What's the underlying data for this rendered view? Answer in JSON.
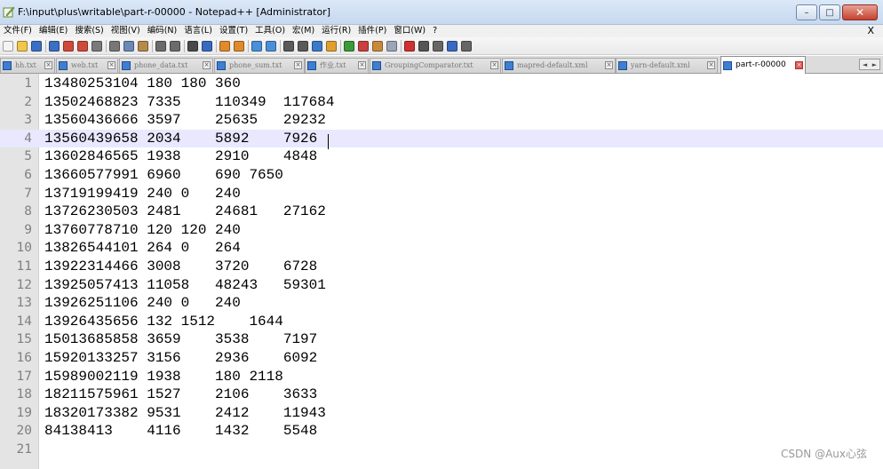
{
  "window": {
    "title": "F:\\input\\plus\\writable\\part-r-00000 - Notepad++ [Administrator]",
    "controls": [
      "–",
      "□",
      "✕"
    ]
  },
  "menubar": {
    "items": [
      "文件(F)",
      "编辑(E)",
      "搜索(S)",
      "视图(V)",
      "编码(N)",
      "语言(L)",
      "设置(T)",
      "工具(O)",
      "宏(M)",
      "运行(R)",
      "插件(P)",
      "窗口(W)",
      "?"
    ],
    "close_label": "X"
  },
  "toolbar": {
    "icons": [
      "new-icon",
      "open-icon",
      "save-icon",
      "save-all-icon",
      "close-icon",
      "close-all-icon",
      "print-icon",
      "cut-icon",
      "copy-icon",
      "paste-icon",
      "undo-icon",
      "redo-icon",
      "find-icon",
      "replace-icon",
      "zoom-in-icon",
      "zoom-out-icon",
      "sync-v-icon",
      "sync-h-icon",
      "word-wrap-icon",
      "all-chars-icon",
      "indent-guide-icon",
      "udl-icon",
      "doc-map-icon",
      "function-list-icon",
      "folder-workspace-icon",
      "monitor-icon",
      "record-macro-icon",
      "stop-macro-icon",
      "play-macro-icon",
      "run-macro-icon",
      "save-macro-icon"
    ]
  },
  "tabs": [
    {
      "label": "hh.txt",
      "active": false
    },
    {
      "label": "web.txt",
      "active": false
    },
    {
      "label": "phone_data.txt",
      "active": false
    },
    {
      "label": "phone_sum.txt",
      "active": false
    },
    {
      "label": "作业.txt",
      "active": false
    },
    {
      "label": "GroupingComparator.txt",
      "active": false
    },
    {
      "label": "mapred-default.xml",
      "active": false
    },
    {
      "label": "yarn-default.xml",
      "active": false
    },
    {
      "label": "part-r-00000",
      "active": true
    }
  ],
  "tab_scroll": [
    "◄",
    "►"
  ],
  "editor": {
    "current_line": 4,
    "lines": [
      {
        "n": "1",
        "text": "13480253104 180 180 360"
      },
      {
        "n": "2",
        "text": "13502468823 7335    110349  117684"
      },
      {
        "n": "3",
        "text": "13560436666 3597    25635   29232"
      },
      {
        "n": "4",
        "text": "13560439658 2034    5892    7926"
      },
      {
        "n": "5",
        "text": "13602846565 1938    2910    4848"
      },
      {
        "n": "6",
        "text": "13660577991 6960    690 7650"
      },
      {
        "n": "7",
        "text": "13719199419 240 0   240"
      },
      {
        "n": "8",
        "text": "13726230503 2481    24681   27162"
      },
      {
        "n": "9",
        "text": "13760778710 120 120 240"
      },
      {
        "n": "10",
        "text": "13826544101 264 0   264"
      },
      {
        "n": "11",
        "text": "13922314466 3008    3720    6728"
      },
      {
        "n": "12",
        "text": "13925057413 11058   48243   59301"
      },
      {
        "n": "13",
        "text": "13926251106 240 0   240"
      },
      {
        "n": "14",
        "text": "13926435656 132 1512    1644"
      },
      {
        "n": "15",
        "text": "15013685858 3659    3538    7197"
      },
      {
        "n": "16",
        "text": "15920133257 3156    2936    6092"
      },
      {
        "n": "17",
        "text": "15989002119 1938    180 2118"
      },
      {
        "n": "18",
        "text": "18211575961 1527    2106    3633"
      },
      {
        "n": "19",
        "text": "18320173382 9531    2412    11943"
      },
      {
        "n": "20",
        "text": "84138413    4116    1432    5548"
      },
      {
        "n": "21",
        "text": ""
      }
    ]
  },
  "watermark": "CSDN @Aux心弦",
  "colors": {
    "current_line": "#e8e8ff",
    "gutter": "#e4e4e4",
    "tab_icon": "#3f7fd1",
    "close_button": "#c4412f"
  }
}
